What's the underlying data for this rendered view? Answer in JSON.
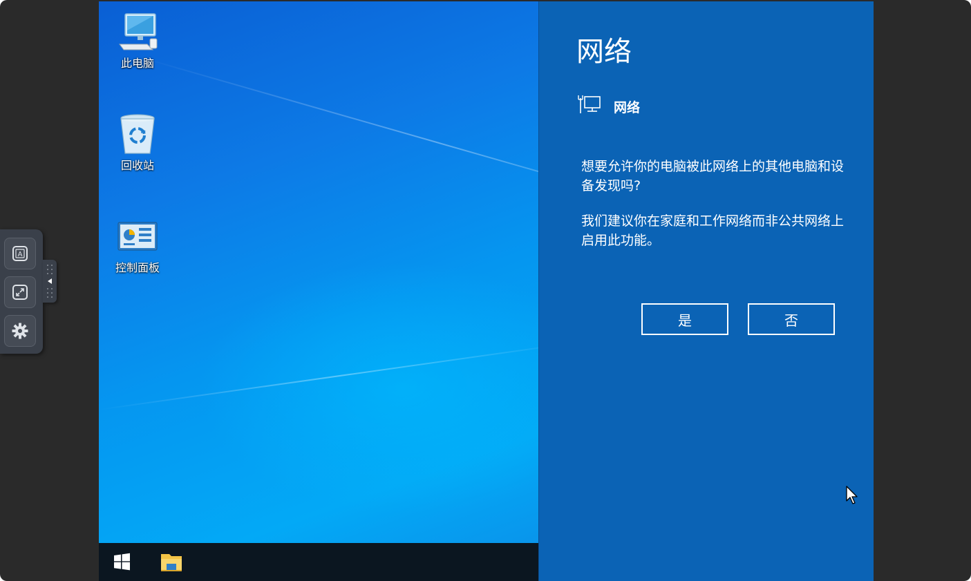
{
  "desktop": {
    "icons": [
      {
        "label": "此电脑",
        "icon": "this-pc-icon"
      },
      {
        "label": "回收站",
        "icon": "recycle-bin-icon"
      },
      {
        "label": "控制面板",
        "icon": "control-panel-icon"
      }
    ]
  },
  "taskbar": {
    "start_icon": "windows-start-icon",
    "explorer_icon": "file-explorer-icon"
  },
  "network_panel": {
    "title": "网络",
    "network_name": "网络",
    "network_icon": "wired-network-icon",
    "question": "想要允许你的电脑被此网络上的其他电脑和设备发现吗?",
    "recommendation": "我们建议你在家庭和工作网络而非公共网络上启用此功能。",
    "yes_label": "是",
    "no_label": "否"
  },
  "side_toolbar": {
    "tools": [
      "keyboard-a-icon",
      "fullscreen-icon",
      "gear-icon"
    ],
    "collapse_icon": "collapse-arrow-icon"
  },
  "colors": {
    "panel_bg": "#0b63b5",
    "taskbar_bg": "#0b1620",
    "frame_bg": "#2a2a2a"
  }
}
